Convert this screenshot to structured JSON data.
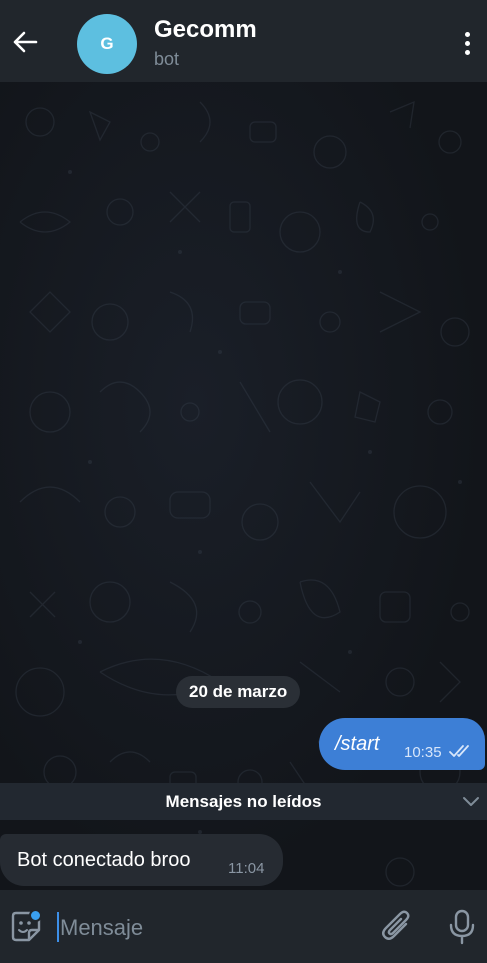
{
  "header": {
    "back_icon": "arrow-left-icon",
    "avatar_letter": "G",
    "avatar_color": "#5dbfe0",
    "title": "Gecomm",
    "subtitle": "bot",
    "menu_icon": "more-vertical-icon"
  },
  "chat": {
    "date_label": "20 de marzo",
    "outgoing": {
      "text": "/start",
      "time": "10:35",
      "status_icon": "double-check-icon",
      "color": "#3d7fd6"
    },
    "unread_label": "Mensajes no leídos",
    "incoming": {
      "text": "Bot conectado broo",
      "time": "11:04"
    }
  },
  "input": {
    "placeholder": "Mensaje",
    "emoji_icon": "sticker-emoji-icon",
    "attach_icon": "paperclip-icon",
    "mic_icon": "microphone-icon"
  }
}
